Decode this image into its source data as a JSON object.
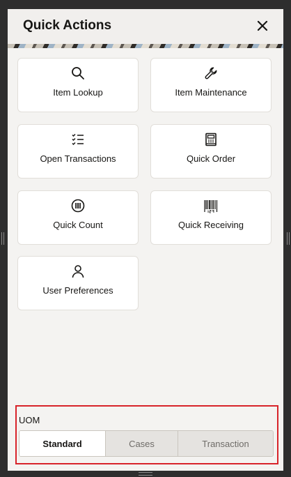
{
  "header": {
    "title": "Quick Actions",
    "close_icon": "close-icon"
  },
  "tiles": [
    {
      "label": "Item Lookup",
      "icon": "search-icon"
    },
    {
      "label": "Item Maintenance",
      "icon": "wrench-icon"
    },
    {
      "label": "Open Transactions",
      "icon": "checklist-icon"
    },
    {
      "label": "Quick Order",
      "icon": "register-icon"
    },
    {
      "label": "Quick Count",
      "icon": "barcode-circle-icon"
    },
    {
      "label": "Quick Receiving",
      "icon": "barcode-icon"
    },
    {
      "label": "User Preferences",
      "icon": "user-icon"
    }
  ],
  "uom": {
    "label": "UOM",
    "options": [
      "Standard",
      "Cases",
      "Transaction"
    ],
    "selected": "Standard"
  },
  "colors": {
    "highlight_border": "#d8232a",
    "text": "#161513",
    "panel_bg": "#f4f3f1"
  }
}
